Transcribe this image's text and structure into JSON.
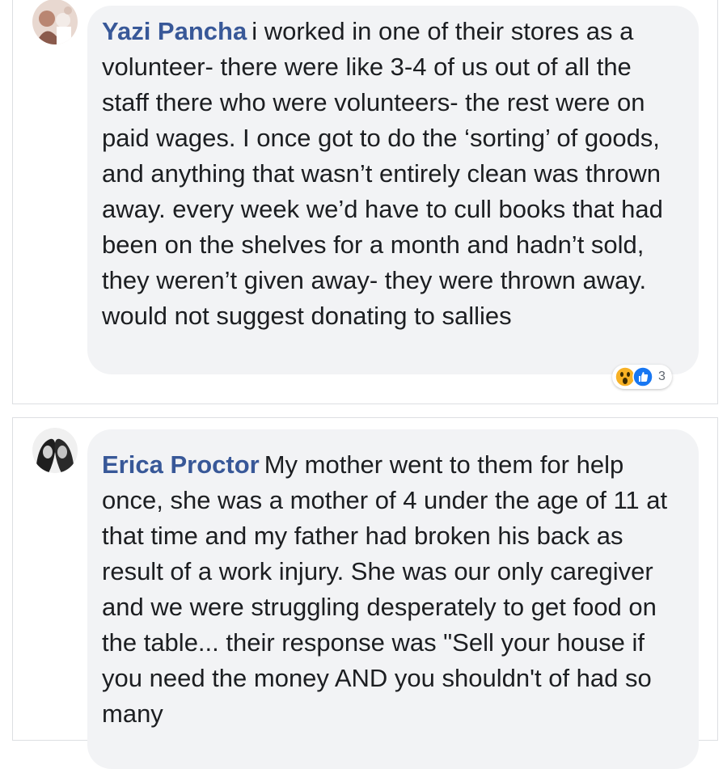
{
  "comments": [
    {
      "author": "Yazi Pancha",
      "text": "i worked in one of their stores as a volunteer- there were like 3-4 of us out of all the staff there who were volunteers- the rest were on paid wages. I once got to do the ‘sorting’ of goods, and anything that wasn’t entirely clean was thrown away. every week we’d have to cull books that had been on the shelves for a month and hadn’t sold, they weren’t given away- they were thrown away. would not suggest donating to sallies",
      "reactions": {
        "icons": [
          "wow-reaction-icon",
          "like-reaction-icon"
        ],
        "count": "3"
      }
    },
    {
      "author": "Erica Proctor",
      "text": "My mother went to them for help once, she was a mother of 4 under the age of 11 at that time and my father had broken his back as result of a work injury. She was our only caregiver and we were struggling desperately to get food on the table... their response was \"Sell your house if you need the money AND you shouldn't of had so many"
    }
  ],
  "colors": {
    "author_link": "#385898",
    "bubble_bg": "#f2f3f5",
    "text": "#1c1e21",
    "like_blue": "#1877f2",
    "wow_yellow": "#f7b125"
  }
}
